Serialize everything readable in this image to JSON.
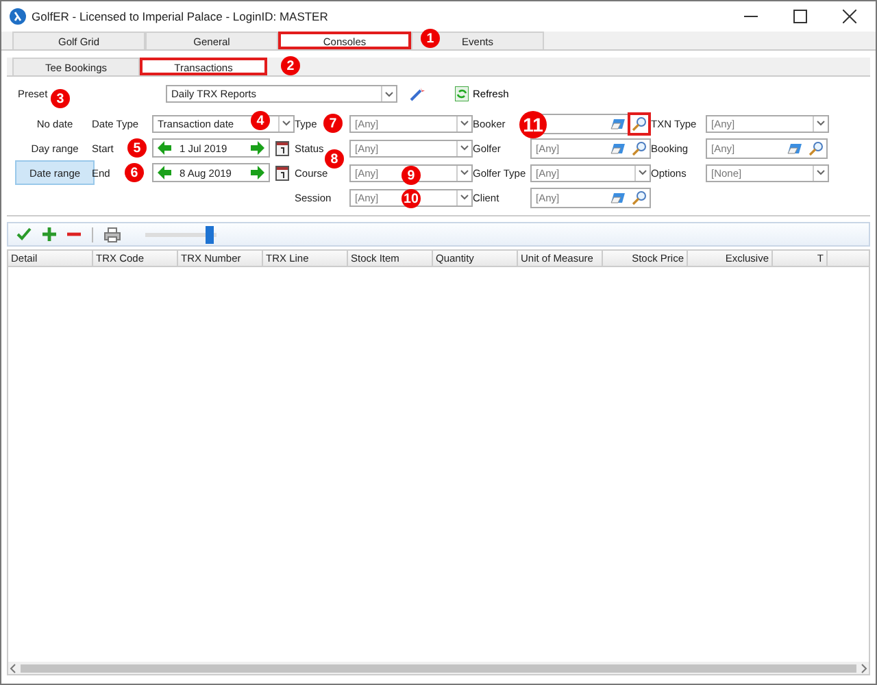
{
  "window": {
    "title": "GolfER - Licensed to Imperial Palace - LoginID: MASTER"
  },
  "tabs": [
    {
      "label": "Golf Grid",
      "selected": false,
      "highlighted": false
    },
    {
      "label": "General",
      "selected": false,
      "highlighted": false
    },
    {
      "label": "Consoles",
      "selected": true,
      "highlighted": true
    },
    {
      "label": "Events",
      "selected": false,
      "highlighted": false
    }
  ],
  "subtabs": [
    {
      "label": "Tee Bookings",
      "selected": false,
      "highlighted": false
    },
    {
      "label": "Transactions",
      "selected": true,
      "highlighted": true
    }
  ],
  "preset": {
    "label": "Preset",
    "value": "Daily TRX Reports",
    "refresh": "Refresh"
  },
  "date_modes": [
    {
      "label": "No date",
      "selected": false
    },
    {
      "label": "Day range",
      "selected": false
    },
    {
      "label": "Date range",
      "selected": true
    }
  ],
  "date_type": {
    "label": "Date Type",
    "value": "Transaction date"
  },
  "dates": [
    {
      "label": "Start",
      "value": "1 Jul 2019"
    },
    {
      "label": "End",
      "value": "8 Aug 2019"
    }
  ],
  "filter_columns": [
    [
      {
        "label": "Type",
        "kind": "dropdown",
        "value": "[Any]"
      },
      {
        "label": "Status",
        "kind": "dropdown",
        "value": "[Any]"
      },
      {
        "label": "Course",
        "kind": "dropdown",
        "value": "[Any]"
      },
      {
        "label": "Session",
        "kind": "dropdown",
        "value": "[Any]"
      }
    ],
    [
      {
        "label": "Booker",
        "kind": "lookup",
        "highlighted": true
      },
      {
        "label": "Golfer",
        "kind": "lookup",
        "value": "[Any]",
        "highlighted": false
      },
      {
        "label": "Golfer Type",
        "kind": "dropdown",
        "value": "[Any]"
      },
      {
        "label": "Client",
        "kind": "lookup",
        "value": "[Any]",
        "highlighted": false
      }
    ],
    [
      {
        "label": "TXN Type",
        "kind": "dropdown",
        "value": "[Any]"
      },
      {
        "label": "Booking",
        "kind": "lookup",
        "value": "[Any]",
        "highlighted": false
      },
      {
        "label": "Options",
        "kind": "dropdown",
        "value": "[None]"
      }
    ]
  ],
  "toolbar": {
    "zoom": {
      "level": 0.9
    }
  },
  "grid": {
    "columns": [
      "Detail",
      "TRX Code",
      "TRX Number",
      "TRX Line",
      "Stock Item",
      "Quantity",
      "Unit of Measure",
      "Stock Price",
      "Exclusive",
      "T"
    ]
  },
  "markers": [
    "1",
    "2",
    "3",
    "4",
    "5",
    "6",
    "7",
    "8",
    "9",
    "10",
    "11"
  ]
}
